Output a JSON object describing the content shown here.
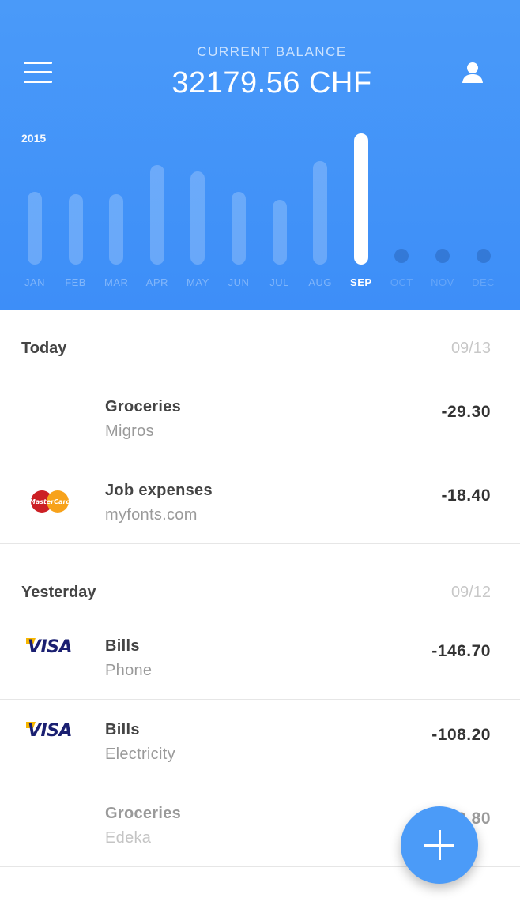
{
  "header": {
    "balance_label": "CURRENT BALANCE",
    "balance_value": "32179.56 CHF",
    "year": "2015",
    "menu_icon": "hamburger-menu-icon",
    "profile_icon": "user-icon",
    "background_color": "#4a9af9"
  },
  "chart_data": {
    "type": "bar",
    "categories": [
      "JAN",
      "FEB",
      "MAR",
      "APR",
      "MAY",
      "JUN",
      "JUL",
      "AUG",
      "SEP",
      "OCT",
      "NOV",
      "DEC"
    ],
    "values": [
      92,
      89,
      89,
      126,
      118,
      92,
      82,
      131,
      166,
      0,
      0,
      0
    ],
    "selected": "SEP",
    "title": "2015",
    "xlabel": "",
    "ylabel": "",
    "grid": false
  },
  "sections": [
    {
      "title": "Today",
      "date": "09/13",
      "transactions": [
        {
          "title": "Groceries",
          "subtitle": "Migros",
          "amount": "-29.30",
          "card": ""
        },
        {
          "title": "Job expenses",
          "subtitle": "myfonts.com",
          "amount": "-18.40",
          "card": "mastercard"
        }
      ]
    },
    {
      "title": "Yesterday",
      "date": "09/12",
      "transactions": [
        {
          "title": "Bills",
          "subtitle": "Phone",
          "amount": "-146.70",
          "card": "visa"
        },
        {
          "title": "Bills",
          "subtitle": "Electricity",
          "amount": "-108.20",
          "card": "visa"
        },
        {
          "title": "Groceries",
          "subtitle": "Edeka",
          "amount": "-29.80",
          "card": ""
        }
      ]
    }
  ],
  "cards": {
    "visa_text": "VISA",
    "mastercard_text": "MasterCard"
  },
  "fab": {
    "icon": "plus-icon",
    "color": "#4b9bf8"
  }
}
